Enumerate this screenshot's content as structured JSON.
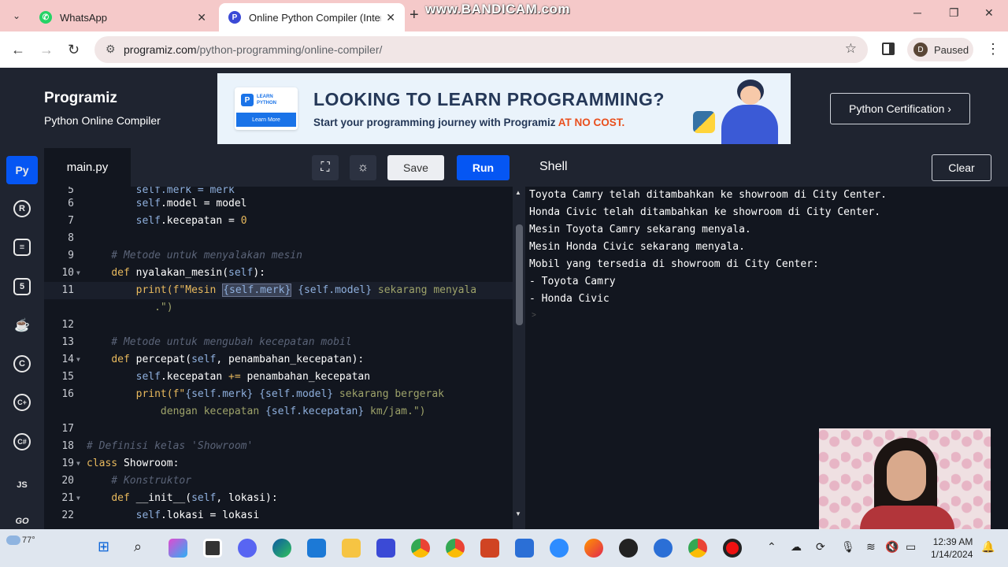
{
  "browser": {
    "tabs": [
      {
        "label": "WhatsApp",
        "close": "✕"
      },
      {
        "label": "Online Python Compiler (Interp",
        "close": "✕"
      }
    ],
    "new_tab": "+",
    "watermark": "www.BANDICAM.com",
    "url_domain": "programiz.com",
    "url_path": "/python-programming/online-compiler/",
    "profile_initial": "D",
    "profile_status": "Paused"
  },
  "header": {
    "logo": "Programiz",
    "subtitle": "Python Online Compiler",
    "banner_badge_title": "LEARN PYTHON",
    "banner_badge_button": "Learn More",
    "banner_headline": "LOOKING TO LEARN PROGRAMMING?",
    "banner_sub_prefix": "Start your programming journey with Programiz ",
    "banner_sub_highlight": "AT NO COST.",
    "cert_button": "Python Certification ›"
  },
  "rail": {
    "items": [
      {
        "name": "python",
        "glyph": "Py"
      },
      {
        "name": "r",
        "glyph": "R"
      },
      {
        "name": "sql",
        "glyph": "≡"
      },
      {
        "name": "html",
        "glyph": "5"
      },
      {
        "name": "java",
        "glyph": "☕"
      },
      {
        "name": "c",
        "glyph": "C"
      },
      {
        "name": "cpp",
        "glyph": "C+"
      },
      {
        "name": "csharp",
        "glyph": "C#"
      },
      {
        "name": "js",
        "glyph": "JS"
      },
      {
        "name": "go",
        "glyph": "GO"
      }
    ]
  },
  "editor": {
    "file_tab": "main.py",
    "save_label": "Save",
    "run_label": "Run",
    "lines": [
      {
        "n": "5",
        "fold": false
      },
      {
        "n": "6",
        "fold": false
      },
      {
        "n": "7",
        "fold": false
      },
      {
        "n": "8",
        "fold": false
      },
      {
        "n": "9",
        "fold": false
      },
      {
        "n": "10",
        "fold": true
      },
      {
        "n": "11",
        "fold": false
      },
      {
        "n": "",
        "fold": false
      },
      {
        "n": "12",
        "fold": false
      },
      {
        "n": "13",
        "fold": false
      },
      {
        "n": "14",
        "fold": true
      },
      {
        "n": "15",
        "fold": false
      },
      {
        "n": "16",
        "fold": false
      },
      {
        "n": "",
        "fold": false
      },
      {
        "n": "17",
        "fold": false
      },
      {
        "n": "18",
        "fold": false
      },
      {
        "n": "19",
        "fold": true
      },
      {
        "n": "20",
        "fold": false
      },
      {
        "n": "21",
        "fold": true
      },
      {
        "n": "22",
        "fold": false
      }
    ],
    "code": {
      "l5": "        self.merk = merk",
      "l6a": "        ",
      "l6self": "self",
      "l6b": ".model = model",
      "l7self": "self",
      "l7b": ".kecepatan = ",
      "l7num": "0",
      "l9": "    # Metode untuk menyalakan mesin",
      "l10kw": "def",
      "l10b": " nyalakan_mesin(",
      "l10self": "self",
      "l10c": "):",
      "l11a": "print(f\"Mesin ",
      "l11sel": "{self.merk}",
      "l11b": " {self.model}",
      "l11c": " sekarang menyala",
      "l11d": ".\")",
      "l13": "    # Metode untuk mengubah kecepatan mobil",
      "l14kw": "def",
      "l14b": " percepat(",
      "l14self": "self",
      "l14c": ", penambahan_kecepatan):",
      "l15self": "self",
      "l15b": ".kecepatan ",
      "l15op": "+=",
      "l15c": " penambahan_kecepatan",
      "l16a": "print(f\"",
      "l16b": "{self.merk}",
      "l16c": " ",
      "l16d": "{self.model}",
      "l16e": " sekarang bergerak",
      "l16f": "dengan kecepatan ",
      "l16g": "{self.kecepatan}",
      "l16h": " km/jam.\")",
      "l18": "# Definisi kelas 'Showroom'",
      "l19kw": "class",
      "l19b": " Showroom:",
      "l20": "    # Konstruktor",
      "l21kw": "def",
      "l21b": " __init__(",
      "l21self": "self",
      "l21c": ", lokasi):",
      "l22self": "self",
      "l22b": ".lokasi = lokasi"
    }
  },
  "shell": {
    "title": "Shell",
    "clear_label": "Clear",
    "output": [
      "Toyota Camry telah ditambahkan ke showroom di City Center.",
      "Honda Civic telah ditambahkan ke showroom di City Center.",
      "Mesin Toyota Camry sekarang menyala.",
      "Mesin Honda Civic sekarang menyala.",
      "Mobil yang tersedia di showroom di City Center:",
      "- Toyota Camry",
      "- Honda Civic"
    ],
    "prompt": ">"
  },
  "taskbar": {
    "temperature": "77°",
    "time": "12:39 AM",
    "date": "1/14/2024"
  }
}
